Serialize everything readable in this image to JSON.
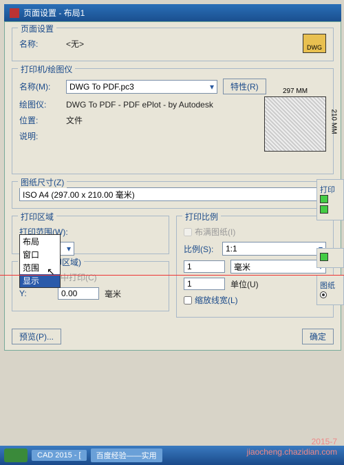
{
  "title": "页面设置 - 布局1",
  "group_page": "页面设置",
  "name_label": "名称:",
  "name_value": "<无>",
  "dwg_badge": "DWG",
  "group_printer": "打印机/绘图仪",
  "printer_name_label": "名称(M):",
  "printer_name_value": "DWG To PDF.pc3",
  "props_btn": "特性(R)",
  "plotter_label": "绘图仪:",
  "plotter_value": "DWG To PDF - PDF ePlot - by Autodesk",
  "location_label": "位置:",
  "location_value": "文件",
  "desc_label": "说明:",
  "preview_w": "297 MM",
  "preview_h": "210 MM",
  "group_paper": "图纸尺寸(Z)",
  "paper_value": "ISO A4 (297.00 x 210.00 毫米)",
  "group_area": "打印区域",
  "range_label": "打印范围(W):",
  "range_value": "布局",
  "range_opts": [
    "布局",
    "窗口",
    "范围",
    "显示"
  ],
  "group_offset": "置在可打印区域)",
  "center_chk": "居中打印(C)",
  "y_label": "Y:",
  "y_value": "0.00",
  "unit_mm": "毫米",
  "group_scale": "打印比例",
  "fit_chk": "布满图纸(I)",
  "ratio_label": "比例(S):",
  "ratio_value": "1:1",
  "scale_val1": "1",
  "unit_combo": "毫米",
  "scale_val2": "1",
  "unit_label": "单位(U)",
  "lw_chk": "缩放线宽(L)",
  "preview_btn": "预览(P)...",
  "ok_btn": "确定",
  "rc_print": "打印",
  "rc_plot": "图纸",
  "taskbar": {
    "t1": "CAD 2015 - [",
    "t2": "百度经验——实用"
  },
  "wm_date": "2015-7",
  "wm_site": "jiaocheng.chazidian.com"
}
